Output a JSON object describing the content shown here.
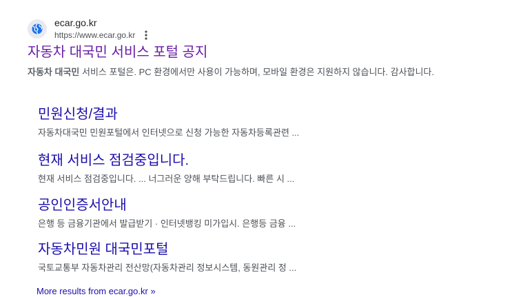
{
  "site": {
    "name": "ecar.go.kr",
    "url": "https://www.ecar.go.kr",
    "favicon_icon": "globe-icon",
    "menu_icon": "more-vert-icon"
  },
  "result": {
    "title": "자동차 대국민 서비스 포털 공지",
    "snippet_bold": "자동차 대국민",
    "snippet_rest": " 서비스 포털은. PC 환경에서만 사용이 가능하며, 모바일 환경은 지원하지 않습니다. 감사합니다."
  },
  "sitelinks": [
    {
      "title": "민원신청/결과",
      "description": "자동차대국민 민원포털에서 인터넷으로 신청 가능한 자동차등록관련 ..."
    },
    {
      "title": "현재 서비스 점검중입니다.",
      "description": "현재 서비스 점검중입니다. ... 너그러운 양해 부탁드립니다. 빠른 시 ..."
    },
    {
      "title": "공인인증서안내",
      "description": "은행 등 금융기관에서 발급받기 · 인터넷뱅킹 미가입시. 은행등 금융 ..."
    },
    {
      "title": "자동차민원 대국민포털",
      "description": "국토교통부 자동차관리 전산망(자동차관리 정보시스템, 동원관리 정 ..."
    }
  ],
  "more_results": "More results from ecar.go.kr »",
  "colors": {
    "visited_link": "#681da8",
    "link": "#1a0dab",
    "snippet": "#4d5156"
  }
}
